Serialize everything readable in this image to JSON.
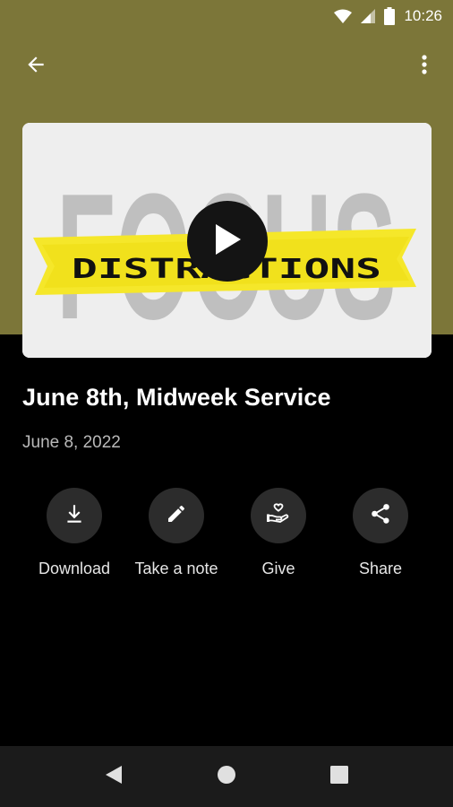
{
  "status_bar": {
    "time": "10:26"
  },
  "app_bar": {
    "back_icon": "arrow-back-icon",
    "menu_icon": "more-vert-icon"
  },
  "media": {
    "artwork_words": {
      "top": "FOCUS",
      "banner": "DISTRACTIONS"
    },
    "play_icon": "play-icon"
  },
  "sermon": {
    "title": "June 8th, Midweek Service",
    "date": "June 8, 2022"
  },
  "actions": [
    {
      "label": "Download",
      "icon": "download-icon"
    },
    {
      "label": "Take a note",
      "icon": "pencil-icon"
    },
    {
      "label": "Give",
      "icon": "give-heart-hand-icon"
    },
    {
      "label": "Share",
      "icon": "share-icon"
    }
  ],
  "colors": {
    "header": "#7c7639",
    "background": "#000000",
    "action_circle": "#2c2c2c",
    "banner_yellow": "#f5e72a"
  }
}
